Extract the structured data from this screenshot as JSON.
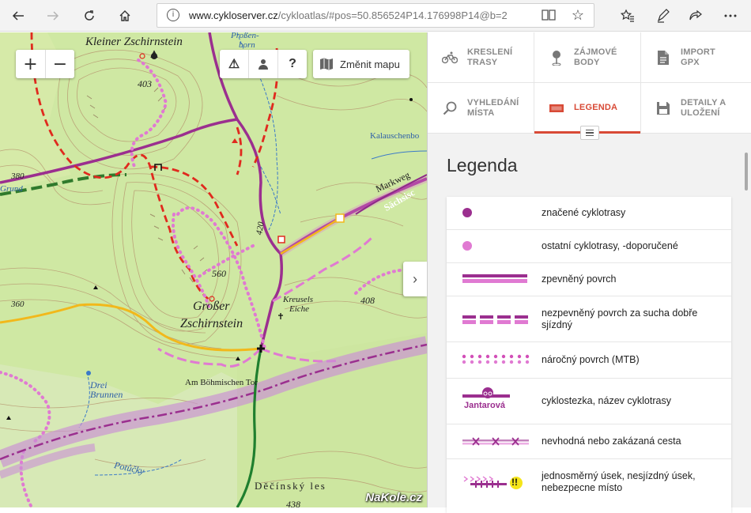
{
  "browser": {
    "url_host": "www.cykloserver.cz",
    "url_path": "/cykloatlas/#pos=50.856524P14.176998P14@b=2",
    "info_icon": "i"
  },
  "map": {
    "labels": {
      "kleiner": "Kleiner Zschirnstein",
      "prossen": "Proßen-",
      "born": "born",
      "grosser1": "Großer",
      "grosser2": "Zschirnstein",
      "kreusels1": "Kreusels",
      "kreusels2": "Eiche",
      "drei1": "Drei",
      "drei2": "Brunnen",
      "tor": "Am Böhmischen Tor",
      "potucky": "Potůčky",
      "decinsky": "Děčínský les",
      "kalausch": "Kalauschenbo",
      "markweg": "Markweg",
      "sachs": "Sächsisc",
      "elev_403": "403",
      "elev_560": "560",
      "elev_408": "408",
      "elev_380": "380",
      "elev_360": "360",
      "elev_420": "420",
      "elev_438": "438",
      "grund": "Grund"
    },
    "controls": {
      "zoom_in": "+",
      "zoom_out": "−",
      "warning": "⚠",
      "help": "?",
      "change_map": "Změnit mapu",
      "panel_toggle": "›"
    }
  },
  "panel": {
    "menu": [
      {
        "label": "KRESLENÍ\nTRASY",
        "icon": "bike-icon"
      },
      {
        "label": "ZÁJMOVÉ\nBODY",
        "icon": "pin-icon"
      },
      {
        "label": "IMPORT\nGPX",
        "icon": "file-icon"
      },
      {
        "label": "VYHLEDÁNÍ\nMÍSTA",
        "icon": "search-icon"
      },
      {
        "label": "LEGENDA",
        "icon": "legend-icon"
      },
      {
        "label": "DETAILY A\nULOŽENÍ",
        "icon": "save-icon"
      }
    ],
    "legend_title": "Legenda",
    "legend": [
      "značené cyklotrasy",
      "ostatní cyklotrasy, -doporučené",
      "zpevněný povrch",
      "nezpevněný povrch za sucha dobře sjízdný",
      "náročný povrch (MTB)",
      "cyklostezka, název cyklotrasy",
      "nevhodná nebo zakázaná cesta",
      "jednosměrný úsek, nesjízdný úsek, nebezpecne místo"
    ],
    "cyklostezka_name": "Jantarová",
    "danger_mark": "!!"
  },
  "colors": {
    "accent": "#d84a36",
    "route_purple": "#9b2f8f",
    "route_pink": "#e07ad2",
    "map_green": "#cfe8a3"
  },
  "watermark": "NaKole.cz"
}
